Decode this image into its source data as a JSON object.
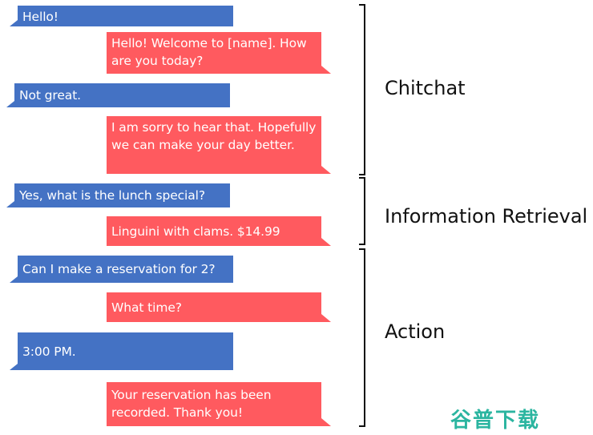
{
  "colors": {
    "user_bubble": "#4472c4",
    "bot_bubble": "#ff5a5f",
    "bracket": "#111111",
    "watermark": "#2bb5a0"
  },
  "messages": [
    {
      "role": "user",
      "text": "Hello!"
    },
    {
      "role": "bot",
      "text": "Hello! Welcome to [name].  How are you today?"
    },
    {
      "role": "user",
      "text": "Not great."
    },
    {
      "role": "bot",
      "text": "I am sorry to hear that. Hopefully we can make your day better."
    },
    {
      "role": "user",
      "text": "Yes, what is the lunch special?"
    },
    {
      "role": "bot",
      "text": "Linguini with clams. $14.99"
    },
    {
      "role": "user",
      "text": "Can I make a reservation for 2?"
    },
    {
      "role": "bot",
      "text": "What time?"
    },
    {
      "role": "user",
      "text": "3:00 PM."
    },
    {
      "role": "bot",
      "text": "Your reservation has been recorded. Thank you!"
    }
  ],
  "categories": [
    {
      "label": "Chitchat"
    },
    {
      "label": "Information Retrieval"
    },
    {
      "label": "Action"
    }
  ],
  "watermark": "谷普下载"
}
